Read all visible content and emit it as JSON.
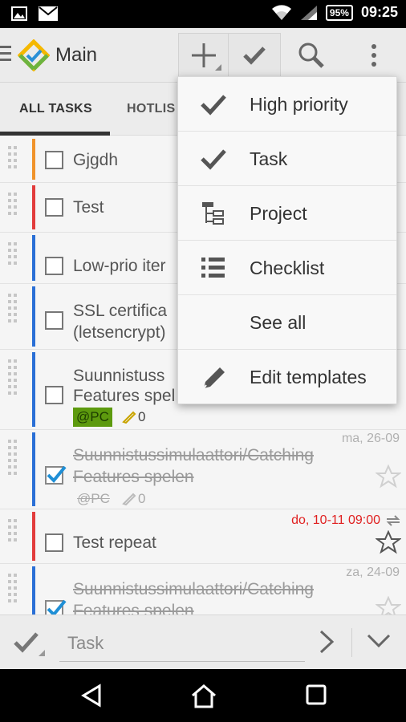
{
  "status_bar": {
    "battery": "95%",
    "time": "09:25"
  },
  "app_bar": {
    "title": "Main"
  },
  "tabs": [
    {
      "label": "ALL TASKS"
    },
    {
      "label": "HOTLIS"
    }
  ],
  "tasks": [
    {
      "title": "Gjgdh",
      "priority_color": "#f0932b",
      "done": false
    },
    {
      "title": "Test",
      "priority_color": "#e23c3c",
      "done": false
    },
    {
      "title": "Low-prio iter",
      "priority_color": "#2a6fd6",
      "done": false
    },
    {
      "title_line1": "SSL certifica",
      "title_line2": "(letsencrypt)",
      "priority_color": "#2a6fd6",
      "done": false
    },
    {
      "title_line1": "Suunnistuss",
      "title_line2": "Features spel",
      "tag": "@PC",
      "attachments": "0",
      "priority_color": "#2a6fd6",
      "done": false
    },
    {
      "title_line1": "Suunnistussimulaattori/Catching",
      "title_line2": "Features spelen",
      "tag": "@PC",
      "attachments": "0",
      "date": "ma, 26-09",
      "priority_color": "#2a6fd6",
      "done": true
    },
    {
      "title": "Test repeat",
      "date": "do, 10-11 09:00",
      "priority_color": "#e23c3c",
      "done": false
    },
    {
      "title_line1": "Suunnistussimulaattori/Catching",
      "title_line2": "Features spelen",
      "date": "za, 24-09",
      "priority_color": "#2a6fd6",
      "done": true
    }
  ],
  "add_menu": {
    "items": [
      {
        "label": "High priority",
        "icon": "checkmark-icon"
      },
      {
        "label": "Task",
        "icon": "checkmark-icon"
      },
      {
        "label": "Project",
        "icon": "project-tree-icon"
      },
      {
        "label": "Checklist",
        "icon": "checklist-icon"
      },
      {
        "label": "See all",
        "icon": ""
      },
      {
        "label": "Edit templates",
        "icon": "pencil-icon"
      }
    ]
  },
  "bottom_bar": {
    "placeholder": "Task"
  },
  "colors": {
    "overdue_date": "#e02020",
    "done_date": "#b0b0b0",
    "tag_bg": "#5d9a0e"
  }
}
